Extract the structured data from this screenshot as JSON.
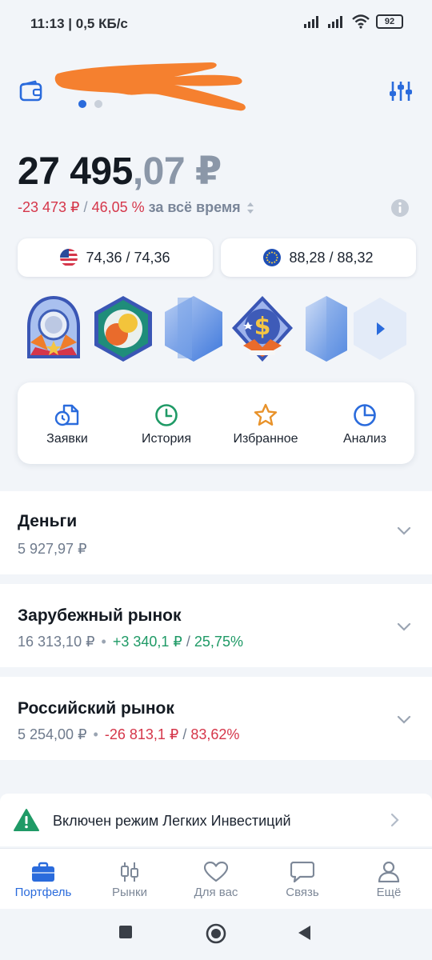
{
  "status_bar": {
    "time_speed": "11:13 | 0,5 КБ/с",
    "battery": "92"
  },
  "header": {
    "wallet_icon": "wallet-icon",
    "settings_icon": "sliders-icon",
    "page_dots": 2,
    "active_page": 1
  },
  "balance": {
    "integer": "27 495",
    "fraction": ",07 ₽"
  },
  "pnl": {
    "amount": "-23 473 ₽",
    "separator": "/",
    "percent": "46,05 %",
    "period": "за всё время"
  },
  "currencies": [
    {
      "flag_icon": "us-flag-icon",
      "rate": "74,36 / 74,36"
    },
    {
      "flag_icon": "eu-flag-icon",
      "rate": "88,28 / 88,32"
    }
  ],
  "actions": [
    {
      "label": "Заявки",
      "icon": "orders-icon"
    },
    {
      "label": "История",
      "icon": "clock-icon"
    },
    {
      "label": "Избранное",
      "icon": "star-icon"
    },
    {
      "label": "Анализ",
      "icon": "pie-chart-icon"
    }
  ],
  "sections": [
    {
      "title": "Деньги",
      "value": "5 927,97 ₽"
    },
    {
      "title": "Зарубежный рынок",
      "value": "16 313,10 ₽",
      "change": "+3 340,1 ₽",
      "percent": "25,75%"
    },
    {
      "title": "Российский рынок",
      "value": "5 254,00 ₽",
      "change": "-26 813,1 ₽",
      "percent": "83,62%"
    }
  ],
  "banner": {
    "text": "Включен режим Легких Инвестиций"
  },
  "bottom_nav": [
    {
      "label": "Портфель",
      "icon": "briefcase-icon",
      "active": true
    },
    {
      "label": "Рынки",
      "icon": "candles-icon",
      "active": false
    },
    {
      "label": "Для вас",
      "icon": "heart-icon",
      "active": false
    },
    {
      "label": "Связь",
      "icon": "chat-icon",
      "active": false
    },
    {
      "label": "Ещё",
      "icon": "profile-icon",
      "active": false
    }
  ],
  "colors": {
    "accent": "#2a6bdc",
    "negative": "#d5364a",
    "positive": "#1f9a66",
    "redaction": "#f5802f"
  }
}
